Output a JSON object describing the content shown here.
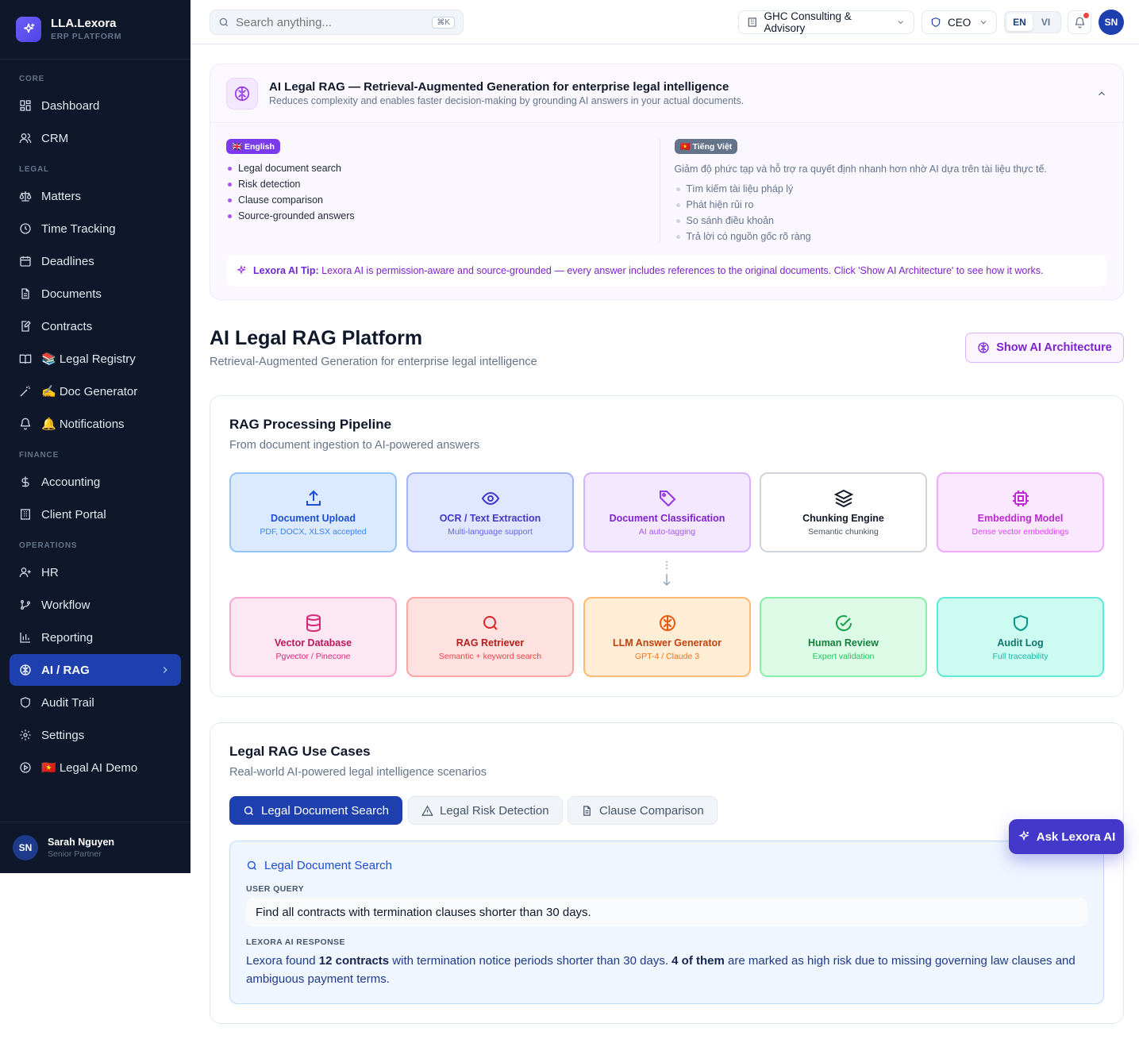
{
  "brand": {
    "name": "LLA.Lexora",
    "sub": "ERP PLATFORM"
  },
  "sidebar": {
    "sections": {
      "core": "CORE",
      "legal": "LEGAL",
      "finance": "FINANCE",
      "operations": "OPERATIONS"
    },
    "items": {
      "dashboard": "Dashboard",
      "crm": "CRM",
      "matters": "Matters",
      "time_tracking": "Time Tracking",
      "deadlines": "Deadlines",
      "documents": "Documents",
      "contracts": "Contracts",
      "legal_registry": "📚 Legal Registry",
      "doc_generator": "✍️ Doc Generator",
      "notifications": "🔔 Notifications",
      "accounting": "Accounting",
      "client_portal": "Client Portal",
      "hr": "HR",
      "workflow": "Workflow",
      "reporting": "Reporting",
      "ai_rag": "AI / RAG",
      "audit_trail": "Audit Trail",
      "settings": "Settings",
      "legal_ai_demo": "🇻🇳 Legal AI Demo"
    },
    "user": {
      "initials": "SN",
      "name": "Sarah Nguyen",
      "role": "Senior Partner"
    }
  },
  "topbar": {
    "search_placeholder": "Search anything...",
    "shortcut": "⌘K",
    "company": "GHC Consulting & Advisory",
    "role": "CEO",
    "lang_en": "EN",
    "lang_vi": "VI",
    "avatar": "SN"
  },
  "info": {
    "title": "AI Legal RAG — Retrieval-Augmented Generation for enterprise legal intelligence",
    "subtitle": "Reduces complexity and enables faster decision-making by grounding AI answers in your actual documents.",
    "en_tag": "🇬🇧 English",
    "en_items": [
      "Legal document search",
      "Risk detection",
      "Clause comparison",
      "Source-grounded answers"
    ],
    "vi_tag": "🇻🇳 Tiếng Việt",
    "vi_desc": "Giảm độ phức tạp và hỗ trợ ra quyết định nhanh hơn nhờ AI dựa trên tài liệu thực tế.",
    "vi_items": [
      "Tìm kiếm tài liệu pháp lý",
      "Phát hiện rủi ro",
      "So sánh điều khoản",
      "Trả lời có nguồn gốc rõ ràng"
    ],
    "tip_label": "Lexora AI Tip:",
    "tip_text": "Lexora AI is permission-aware and source-grounded — every answer includes references to the original documents. Click 'Show AI Architecture' to see how it works."
  },
  "page": {
    "title": "AI Legal RAG Platform",
    "subtitle": "Retrieval-Augmented Generation for enterprise legal intelligence",
    "arch_button": "Show AI Architecture"
  },
  "pipeline": {
    "title": "RAG Processing Pipeline",
    "subtitle": "From document ingestion to AI-powered answers",
    "steps": [
      {
        "title": "Document Upload",
        "sub": "PDF, DOCX, XLSX accepted"
      },
      {
        "title": "OCR / Text Extraction",
        "sub": "Multi-language support"
      },
      {
        "title": "Document Classification",
        "sub": "AI auto-tagging"
      },
      {
        "title": "Chunking Engine",
        "sub": "Semantic chunking"
      },
      {
        "title": "Embedding Model",
        "sub": "Dense vector embeddings"
      },
      {
        "title": "Vector Database",
        "sub": "Pgvector / Pinecone"
      },
      {
        "title": "RAG Retriever",
        "sub": "Semantic + keyword search"
      },
      {
        "title": "LLM Answer Generator",
        "sub": "GPT-4 / Claude 3"
      },
      {
        "title": "Human Review",
        "sub": "Expert validation"
      },
      {
        "title": "Audit Log",
        "sub": "Full traceability"
      }
    ]
  },
  "use_cases": {
    "title": "Legal RAG Use Cases",
    "subtitle": "Real-world AI-powered legal intelligence scenarios",
    "tabs": [
      "Legal Document Search",
      "Legal Risk Detection",
      "Clause Comparison"
    ],
    "panel_title": "Legal Document Search",
    "query_label": "USER QUERY",
    "query": "Find all contracts with termination clauses shorter than 30 days.",
    "response_label": "LEXORA AI RESPONSE",
    "response_1": "Lexora found ",
    "response_b1": "12 contracts",
    "response_2": " with termination notice periods shorter than 30 days. ",
    "response_b2": "4 of them",
    "response_3": " are marked as high risk due to missing governing law clauses and ambiguous payment terms."
  },
  "ask_button": "Ask Lexora AI",
  "colors": {
    "sidebar_bg": "#0f172a",
    "active_nav": "#1e40af",
    "accent_purple": "#7c3aed",
    "ask_button": "#4338ca"
  }
}
